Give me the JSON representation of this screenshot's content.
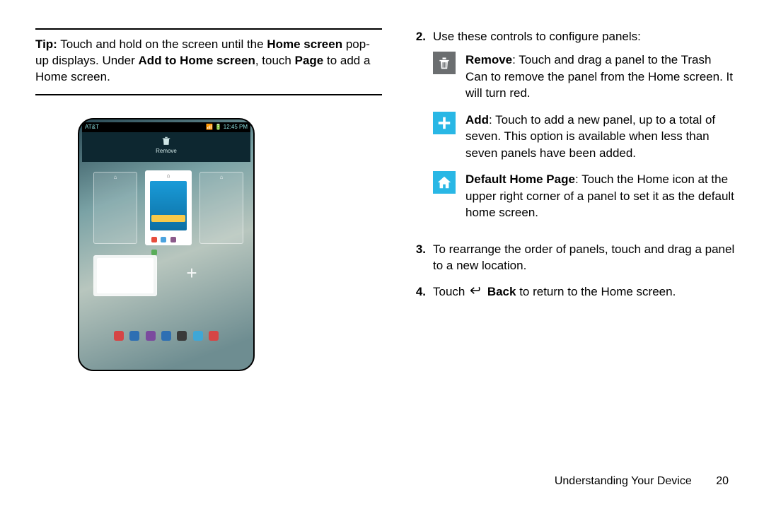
{
  "tip": {
    "label": "Tip:",
    "part1": " Touch and hold on the screen until the ",
    "bold1": "Home screen",
    "part2": " pop-up displays. Under ",
    "bold2": "Add to Home screen",
    "part3": ", touch ",
    "bold3": "Page",
    "part4": " to add a Home screen."
  },
  "device": {
    "carrier": "AT&T",
    "time": "12:45 PM",
    "removeLabel": "Remove"
  },
  "step2": {
    "num": "2.",
    "intro": "Use these controls to configure panels:",
    "remove": {
      "label": "Remove",
      "text": ": Touch and drag a panel to the Trash Can to remove the panel from the Home screen. It will turn red."
    },
    "add": {
      "label": "Add",
      "text": ": Touch to add a new panel, up to a total of seven. This option is available when less than seven panels have been added."
    },
    "default": {
      "label": "Default Home Page",
      "text": ": Touch the Home icon at the upper right corner of a panel to set it as the default home screen."
    }
  },
  "step3": {
    "num": "3.",
    "text": "To rearrange the order of panels, touch and drag a panel to a new location."
  },
  "step4": {
    "num": "4.",
    "part1": "Touch ",
    "bold": "Back",
    "part2": " to return to the Home screen."
  },
  "footer": {
    "section": "Understanding Your Device",
    "page": "20"
  }
}
